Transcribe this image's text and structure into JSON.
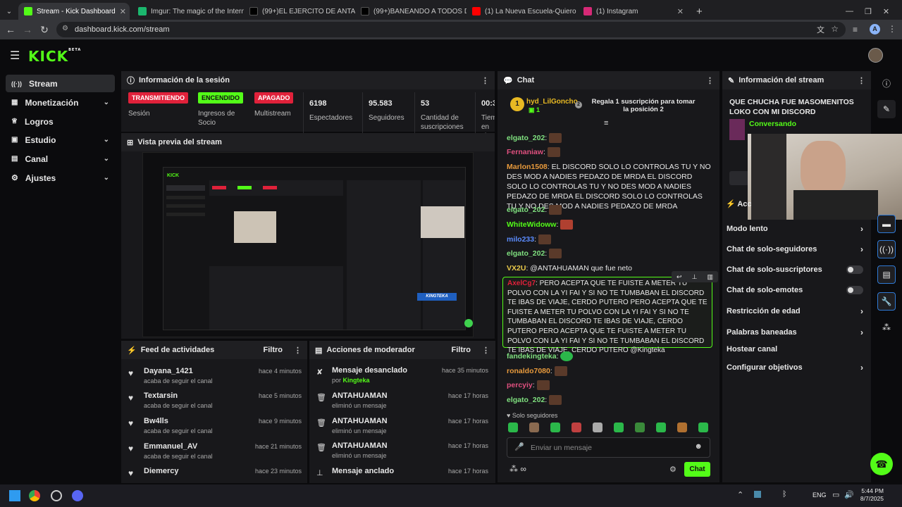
{
  "tabs": [
    {
      "title": "Stream - Kick Dashboard",
      "color": "#53fc18"
    },
    {
      "title": "Imgur: The magic of the Interne",
      "color": "#1bb76e"
    },
    {
      "title": "(99+)EL EJERCITO DE ANTAHUA",
      "color": "#000000"
    },
    {
      "title": "(99+)BANEANDO A TODOS DE",
      "color": "#000000"
    },
    {
      "title": "(1) La Nueva Escuela-Quiero Be",
      "color": "#ff0000"
    },
    {
      "title": "(1) Instagram",
      "color": "#d62976"
    }
  ],
  "url": "dashboard.kick.com/stream",
  "logo": "KICK",
  "logo_sup": "BETA",
  "sidebar": [
    {
      "label": "Stream",
      "icon": "((·))"
    },
    {
      "label": "Monetización",
      "icon": "▦"
    },
    {
      "label": "Logros",
      "icon": "🏆"
    },
    {
      "label": "Estudio",
      "icon": "▣"
    },
    {
      "label": "Canal",
      "icon": "▤"
    },
    {
      "label": "Ajustes",
      "icon": "⚙"
    }
  ],
  "session": {
    "title": "Información de la sesión",
    "stats": [
      {
        "badge": "TRANSMITIENDO",
        "label": "Sesión"
      },
      {
        "badge": "ENCENDIDO",
        "label": "Ingresos de Socio"
      },
      {
        "badge": "APAGADO",
        "label": "Multistream"
      },
      {
        "value": "6198",
        "label": "Espectadores"
      },
      {
        "value": "95.583",
        "label": "Seguidores"
      },
      {
        "value": "53",
        "label": "Cantidad de suscripciones"
      },
      {
        "value": "00:3",
        "label": "Tiem en vi"
      }
    ]
  },
  "preview": {
    "title": "Vista previa del stream",
    "watermark": "KINGTEKA"
  },
  "feed": {
    "title": "Feed de actividades",
    "filter": "Filtro",
    "items": [
      {
        "name": "Dayana_1421",
        "sub": "acaba de seguir el canal",
        "time": "hace 4 minutos"
      },
      {
        "name": "Textarsin",
        "sub": "acaba de seguir el canal",
        "time": "hace 5 minutos"
      },
      {
        "name": "Bw4lls",
        "sub": "acaba de seguir el canal",
        "time": "hace 9 minutos"
      },
      {
        "name": "Emmanuel_AV",
        "sub": "acaba de seguir el canal",
        "time": "hace 21 minutos"
      },
      {
        "name": "Diemercy",
        "sub": "",
        "time": "hace 23 minutos"
      }
    ]
  },
  "mod": {
    "title": "Acciones de moderador",
    "filter": "Filtro",
    "items": [
      {
        "name": "Mensaje desanclado",
        "sub_prefix": "por ",
        "sub_user": "Kingteka",
        "time": "hace 35 minutos",
        "icon": "✘"
      },
      {
        "name": "ANTAHUAMAN",
        "sub": "eliminó un mensaje",
        "time": "hace 17 horas",
        "icon": "🗑"
      },
      {
        "name": "ANTAHUAMAN",
        "sub": "eliminó un mensaje",
        "time": "hace 17 horas",
        "icon": "🗑"
      },
      {
        "name": "ANTAHUAMAN",
        "sub": "eliminó un mensaje",
        "time": "hace 17 horas",
        "icon": "🗑"
      },
      {
        "name": "Mensaje anclado",
        "sub": "",
        "time": "hace 17 horas",
        "icon": "📌"
      }
    ]
  },
  "chat": {
    "title": "Chat",
    "gift_user": "hyd_LilGoncho",
    "gift_count": "1",
    "gift_rank": "1",
    "gift_msg": "Regala 1 suscripción para tomar la posición 2",
    "messages": [
      {
        "user": "elgato_202",
        "color": "#7fe07f",
        "text": ""
      },
      {
        "user": "Fernaniaw",
        "color": "#e0507f",
        "text": ""
      },
      {
        "user": "Marlon1508",
        "color": "#e89a3c",
        "text": " EL DISCORD SOLO LO CONTROLAS TU Y NO DES MOD A NADIES PEDAZO DE MRDA EL DISCORD SOLO LO CONTROLAS TU Y NO DES MOD A NADIES PEDAZO DE MRDA EL DISCORD SOLO LO CONTROLAS TU Y NO DES MOD A NADIES PEDAZO DE MRDA"
      },
      {
        "user": "elgato_202",
        "color": "#7fe07f",
        "text": ""
      },
      {
        "user": "WhiteWidoww",
        "color": "#53fc18",
        "text": ""
      },
      {
        "user": "milo233",
        "color": "#5b8cff",
        "text": ""
      },
      {
        "user": "elgato_202",
        "color": "#7fe07f",
        "text": ""
      },
      {
        "user": "VX2U",
        "color": "#e8c84a",
        "text": " @ANTAHUAMAN que fue neto"
      }
    ],
    "pinned_user": "AxelCg7",
    "pinned_text": " PERO ACEPTA QUE TE FUISTE A METER TU POLVO CON LA YI FAI Y SI NO TE TUMBABAN EL DISCORD TE IBAS DE VIAJE, CERDO PUTERO  PERO ACEPTA QUE TE FUISTE A METER TU POLVO CON LA YI FAI Y SI NO TE TUMBABAN EL DISCORD TE IBAS DE VIAJE, CERDO PUTERO  PERO ACEPTA QUE TE FUISTE A METER TU POLVO CON LA YI FAI Y SI NO TE TUMBABAN EL DISCORD TE IBAS DE VIAJE, CERDO PUTERO  @Kingteka",
    "after": [
      {
        "user": "fandekingteka",
        "color": "#7fe07f"
      },
      {
        "user": "ronaldo7080",
        "color": "#e89a3c"
      },
      {
        "user": "percyiy",
        "color": "#e0507f"
      },
      {
        "user": "elgato_202",
        "color": "#7fe07f"
      }
    ],
    "followers_only": "Solo seguidores",
    "placeholder": "Enviar un mensaje",
    "send": "Chat"
  },
  "info": {
    "title": "Información del stream",
    "stream_title": "QUE CHUCHA FUE MASOMENITOS LOKO CON MI DISCORD",
    "category": "Conversando",
    "section_prefix": "Acc"
  },
  "options": [
    {
      "label": "Modo lento",
      "kind": "arrow"
    },
    {
      "label": "Chat de solo-seguidores",
      "kind": "arrow"
    },
    {
      "label": "Chat de solo-suscriptores",
      "kind": "toggle"
    },
    {
      "label": "Chat de solo-emotes",
      "kind": "toggle"
    },
    {
      "label": "Restricción de edad",
      "kind": "arrow"
    },
    {
      "label": "Palabras baneadas",
      "kind": "arrow"
    },
    {
      "label": "Hostear canal",
      "kind": "none"
    },
    {
      "label": "Configurar objetivos",
      "kind": "arrow"
    }
  ],
  "taskbar": {
    "lang": "ENG",
    "time": "5:44 PM",
    "date": "8/7/2025"
  },
  "colors": {
    "accent": "#53fc18",
    "live": "#e0213a"
  }
}
